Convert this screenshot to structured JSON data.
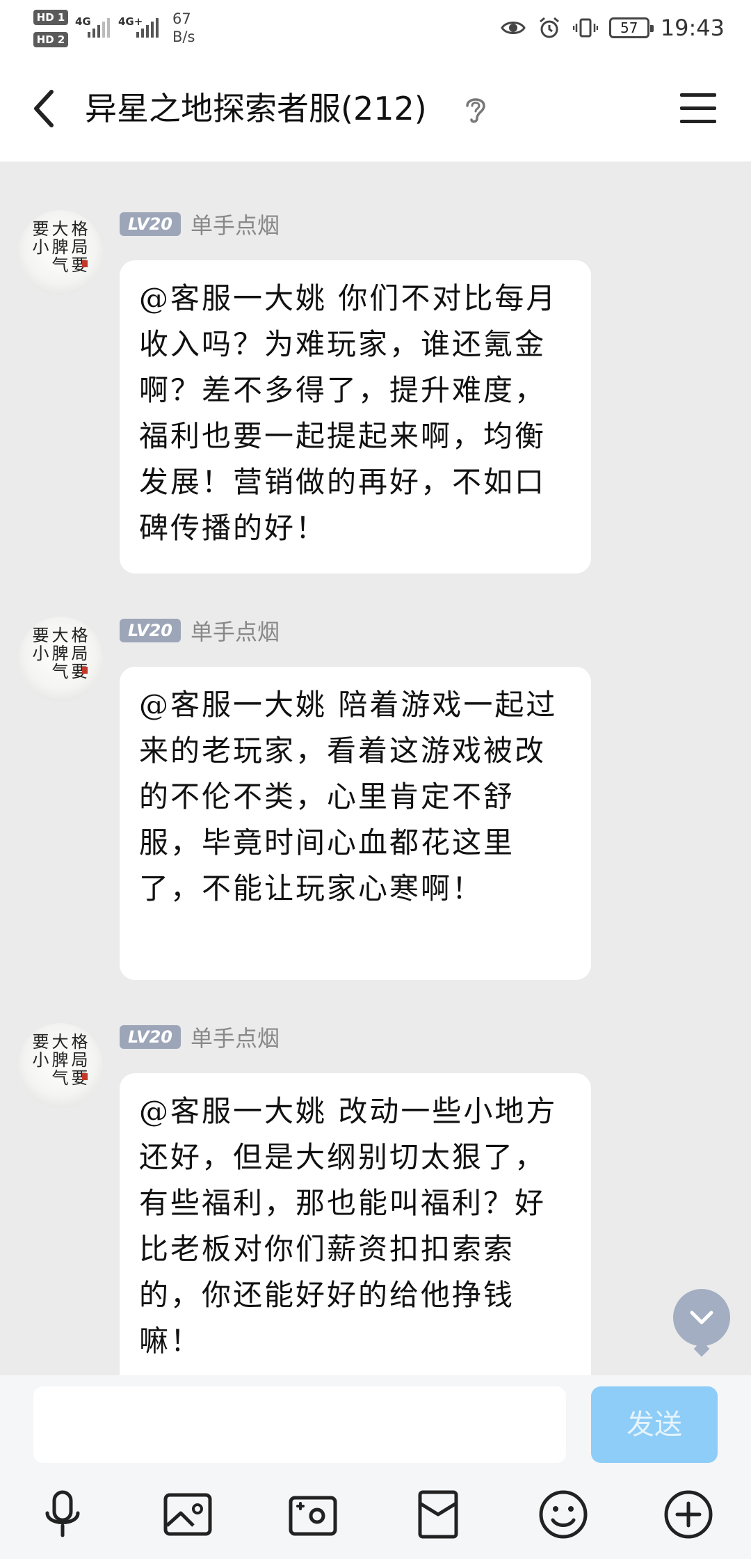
{
  "status_bar": {
    "sim1": "HD 1",
    "sim2": "HD 2",
    "net1": "4G",
    "net2": "4G+",
    "speed_value": "67",
    "speed_unit": "B/s",
    "battery": "57",
    "time": "19:43",
    "icons": [
      "eye-icon",
      "alarm-icon",
      "vibrate-icon",
      "battery-icon"
    ]
  },
  "header": {
    "title": "异星之地探索者服(212)",
    "icons": [
      "back-icon",
      "ear-icon",
      "menu-icon"
    ]
  },
  "messages": [
    {
      "level": "LV20",
      "nickname": "单手点烟",
      "text": "@客服一大姚 你们不对比每月收入吗？为难玩家，谁还氪金啊？差不多得了，提升难度，福利也要一起提起来啊，均衡发展！营销做的再好，不如口碑传播的好！"
    },
    {
      "level": "LV20",
      "nickname": "单手点烟",
      "text": "@客服一大姚 陪着游戏一起过来的老玩家，看着这游戏被改的不伦不类，心里肯定不舒服，毕竟时间心血都花这里了，不能让玩家心寒啊！"
    },
    {
      "level": "LV20",
      "nickname": "单手点烟",
      "text": "@客服一大姚 改动一些小地方还好，但是大纲别切太狠了，有些福利，那也能叫福利？好比老板对你们薪资扣扣索索的，你还能好好的给他挣钱嘛！"
    }
  ],
  "input": {
    "value": "",
    "placeholder": "",
    "send_label": "发送"
  },
  "toolbar": [
    "microphone-icon",
    "image-icon",
    "camera-icon",
    "red-packet-icon",
    "emoji-icon",
    "plus-icon"
  ]
}
